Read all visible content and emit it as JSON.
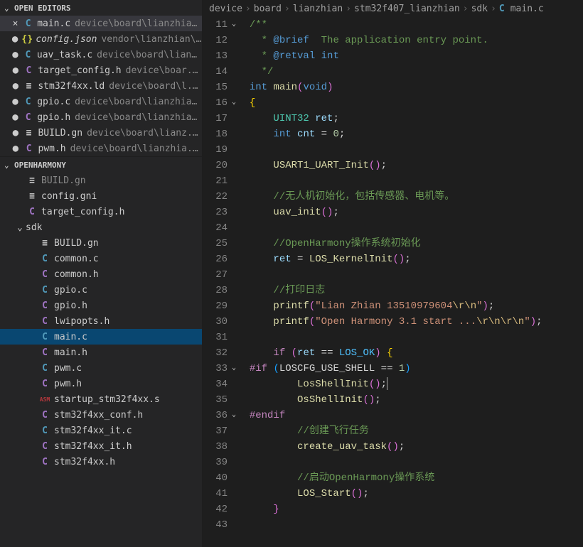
{
  "sections": {
    "openEditors": "OPEN EDITORS",
    "explorer": "OPENHARMONY"
  },
  "openEditors": [
    {
      "icon": "C",
      "iconClass": "icon-c",
      "name": "main.c",
      "path": "device\\board\\lianzhia...",
      "active": true,
      "close": true
    },
    {
      "icon": "{}",
      "iconClass": "icon-json",
      "name": "config.json",
      "path": "vendor\\lianzhian\\...",
      "italic": true,
      "dirty": true
    },
    {
      "icon": "C",
      "iconClass": "icon-c",
      "name": "uav_task.c",
      "path": "device\\board\\lian...",
      "dirty": true
    },
    {
      "icon": "C",
      "iconClass": "icon-h",
      "name": "target_config.h",
      "path": "device\\boar...",
      "dirty": true
    },
    {
      "icon": "≡",
      "iconClass": "icon-gn",
      "name": "stm32f4xx.ld",
      "path": "device\\board\\l...",
      "dirty": true
    },
    {
      "icon": "C",
      "iconClass": "icon-c",
      "name": "gpio.c",
      "path": "device\\board\\lianzhia...",
      "dirty": true
    },
    {
      "icon": "C",
      "iconClass": "icon-h",
      "name": "gpio.h",
      "path": "device\\board\\lianzhia...",
      "dirty": true
    },
    {
      "icon": "≡",
      "iconClass": "icon-gn",
      "name": "BUILD.gn",
      "path": "device\\board\\lianz...",
      "dirty": true
    },
    {
      "icon": "C",
      "iconClass": "icon-h",
      "name": "pwm.h",
      "path": "device\\board\\lianzhia...",
      "dirty": true
    }
  ],
  "tree": [
    {
      "type": "file",
      "icon": "≡",
      "iconClass": "icon-gn",
      "name": "BUILD.gn",
      "depth": 1,
      "cut": true
    },
    {
      "type": "file",
      "icon": "≡",
      "iconClass": "icon-gn",
      "name": "config.gni",
      "depth": 1
    },
    {
      "type": "file",
      "icon": "C",
      "iconClass": "icon-h",
      "name": "target_config.h",
      "depth": 1
    },
    {
      "type": "folder",
      "name": "sdk",
      "open": true,
      "depth": 0
    },
    {
      "type": "file",
      "icon": "≡",
      "iconClass": "icon-gn",
      "name": "BUILD.gn",
      "depth": 2
    },
    {
      "type": "file",
      "icon": "C",
      "iconClass": "icon-c",
      "name": "common.c",
      "depth": 2
    },
    {
      "type": "file",
      "icon": "C",
      "iconClass": "icon-h",
      "name": "common.h",
      "depth": 2
    },
    {
      "type": "file",
      "icon": "C",
      "iconClass": "icon-c",
      "name": "gpio.c",
      "depth": 2
    },
    {
      "type": "file",
      "icon": "C",
      "iconClass": "icon-h",
      "name": "gpio.h",
      "depth": 2
    },
    {
      "type": "file",
      "icon": "C",
      "iconClass": "icon-h",
      "name": "lwipopts.h",
      "depth": 2
    },
    {
      "type": "file",
      "icon": "C",
      "iconClass": "icon-c",
      "name": "main.c",
      "depth": 2,
      "selected": true
    },
    {
      "type": "file",
      "icon": "C",
      "iconClass": "icon-h",
      "name": "main.h",
      "depth": 2
    },
    {
      "type": "file",
      "icon": "C",
      "iconClass": "icon-c",
      "name": "pwm.c",
      "depth": 2
    },
    {
      "type": "file",
      "icon": "C",
      "iconClass": "icon-h",
      "name": "pwm.h",
      "depth": 2
    },
    {
      "type": "file",
      "icon": "ASM",
      "iconClass": "icon-asm",
      "name": "startup_stm32f4xx.s",
      "depth": 2
    },
    {
      "type": "file",
      "icon": "C",
      "iconClass": "icon-h",
      "name": "stm32f4xx_conf.h",
      "depth": 2
    },
    {
      "type": "file",
      "icon": "C",
      "iconClass": "icon-c",
      "name": "stm32f4xx_it.c",
      "depth": 2
    },
    {
      "type": "file",
      "icon": "C",
      "iconClass": "icon-h",
      "name": "stm32f4xx_it.h",
      "depth": 2
    },
    {
      "type": "file",
      "icon": "C",
      "iconClass": "icon-h",
      "name": "stm32f4xx.h",
      "depth": 2
    }
  ],
  "breadcrumbs": [
    "device",
    "board",
    "lianzhian",
    "stm32f407_lianzhian",
    "sdk",
    "main.c"
  ],
  "lineStart": 11,
  "lineEnd": 43,
  "code": [
    {
      "n": 11,
      "fold": "v",
      "t": [
        [
          "  ",
          "plain"
        ],
        [
          "/**",
          "comment"
        ]
      ]
    },
    {
      "n": 12,
      "t": [
        [
          "    * ",
          "comment"
        ],
        [
          "@brief",
          "doctag"
        ],
        [
          "  The application entry point.",
          "comment"
        ]
      ]
    },
    {
      "n": 13,
      "t": [
        [
          "    * ",
          "comment"
        ],
        [
          "@retval",
          "doctag"
        ],
        [
          " ",
          "comment"
        ],
        [
          "int",
          "keyword"
        ]
      ]
    },
    {
      "n": 14,
      "t": [
        [
          "    */",
          "comment"
        ]
      ]
    },
    {
      "n": 15,
      "t": [
        [
          "  ",
          "plain"
        ],
        [
          "int",
          "keyword"
        ],
        [
          " ",
          "plain"
        ],
        [
          "main",
          "func"
        ],
        [
          "(",
          "paren"
        ],
        [
          "void",
          "keyword"
        ],
        [
          ")",
          "paren"
        ]
      ]
    },
    {
      "n": 16,
      "fold": "v",
      "t": [
        [
          "  ",
          "plain"
        ],
        [
          "{",
          "brace"
        ]
      ]
    },
    {
      "n": 17,
      "t": [
        [
          "      ",
          "plain"
        ],
        [
          "UINT32",
          "type"
        ],
        [
          " ",
          "plain"
        ],
        [
          "ret",
          "var"
        ],
        [
          ";",
          "plain"
        ]
      ]
    },
    {
      "n": 18,
      "t": [
        [
          "      ",
          "plain"
        ],
        [
          "int",
          "keyword"
        ],
        [
          " ",
          "plain"
        ],
        [
          "cnt",
          "var"
        ],
        [
          " = ",
          "plain"
        ],
        [
          "0",
          "num"
        ],
        [
          ";",
          "plain"
        ]
      ]
    },
    {
      "n": 19,
      "t": []
    },
    {
      "n": 20,
      "t": [
        [
          "      ",
          "plain"
        ],
        [
          "USART1_UART_Init",
          "func"
        ],
        [
          "()",
          "paren"
        ],
        [
          ";",
          "plain"
        ]
      ]
    },
    {
      "n": 21,
      "t": []
    },
    {
      "n": 22,
      "t": [
        [
          "      ",
          "plain"
        ],
        [
          "//无人机初始化，包括传感器、电机等。",
          "comment"
        ]
      ]
    },
    {
      "n": 23,
      "t": [
        [
          "      ",
          "plain"
        ],
        [
          "uav_init",
          "func"
        ],
        [
          "()",
          "paren"
        ],
        [
          ";",
          "plain"
        ]
      ]
    },
    {
      "n": 24,
      "t": []
    },
    {
      "n": 25,
      "t": [
        [
          "      ",
          "plain"
        ],
        [
          "//OpenHarmony操作系统初始化",
          "comment"
        ]
      ]
    },
    {
      "n": 26,
      "t": [
        [
          "      ",
          "plain"
        ],
        [
          "ret",
          "var"
        ],
        [
          " = ",
          "plain"
        ],
        [
          "LOS_KernelInit",
          "func"
        ],
        [
          "()",
          "paren"
        ],
        [
          ";",
          "plain"
        ]
      ]
    },
    {
      "n": 27,
      "t": []
    },
    {
      "n": 28,
      "t": [
        [
          "      ",
          "plain"
        ],
        [
          "//打印日志",
          "comment"
        ]
      ]
    },
    {
      "n": 29,
      "t": [
        [
          "      ",
          "plain"
        ],
        [
          "printf",
          "func"
        ],
        [
          "(",
          "paren"
        ],
        [
          "\"Lian Zhian 13510979604",
          "str"
        ],
        [
          "\\r\\n",
          "esc"
        ],
        [
          "\"",
          "str"
        ],
        [
          ")",
          "paren"
        ],
        [
          ";",
          "plain"
        ]
      ]
    },
    {
      "n": 30,
      "t": [
        [
          "      ",
          "plain"
        ],
        [
          "printf",
          "func"
        ],
        [
          "(",
          "paren"
        ],
        [
          "\"Open Harmony 3.1 start ...",
          "str"
        ],
        [
          "\\r\\n\\r\\n",
          "esc"
        ],
        [
          "\"",
          "str"
        ],
        [
          ")",
          "paren"
        ],
        [
          ";",
          "plain"
        ]
      ]
    },
    {
      "n": 31,
      "t": []
    },
    {
      "n": 32,
      "t": [
        [
          "      ",
          "plain"
        ],
        [
          "if",
          "macro"
        ],
        [
          " ",
          "plain"
        ],
        [
          "(",
          "paren"
        ],
        [
          "ret",
          "var"
        ],
        [
          " == ",
          "plain"
        ],
        [
          "LOS_OK",
          "const"
        ],
        [
          ")",
          "paren"
        ],
        [
          " ",
          "plain"
        ],
        [
          "{",
          "brace"
        ]
      ]
    },
    {
      "n": 33,
      "fold": "v",
      "t": [
        [
          "  ",
          "plain"
        ],
        [
          "#if",
          "macro"
        ],
        [
          " ",
          "plain"
        ],
        [
          "(",
          "paren2"
        ],
        [
          "LOSCFG_USE_SHELL == ",
          "plain"
        ],
        [
          "1",
          "num"
        ],
        [
          ")",
          "paren2"
        ]
      ]
    },
    {
      "n": 34,
      "t": [
        [
          "          ",
          "plain"
        ],
        [
          "LosShellInit",
          "func"
        ],
        [
          "()",
          "paren"
        ],
        [
          ";",
          "plain"
        ],
        [
          "",
          "cursor"
        ]
      ]
    },
    {
      "n": 35,
      "t": [
        [
          "          ",
          "plain"
        ],
        [
          "OsShellInit",
          "func"
        ],
        [
          "()",
          "paren"
        ],
        [
          ";",
          "plain"
        ]
      ]
    },
    {
      "n": 36,
      "fold": "v",
      "t": [
        [
          "  ",
          "plain"
        ],
        [
          "#endif",
          "macro"
        ]
      ]
    },
    {
      "n": 37,
      "t": [
        [
          "          ",
          "plain"
        ],
        [
          "//创建飞行任务",
          "comment"
        ]
      ]
    },
    {
      "n": 38,
      "t": [
        [
          "          ",
          "plain"
        ],
        [
          "create_uav_task",
          "func"
        ],
        [
          "()",
          "paren"
        ],
        [
          ";",
          "plain"
        ]
      ]
    },
    {
      "n": 39,
      "t": []
    },
    {
      "n": 40,
      "t": [
        [
          "          ",
          "plain"
        ],
        [
          "//启动OpenHarmony操作系统",
          "comment"
        ]
      ]
    },
    {
      "n": 41,
      "t": [
        [
          "          ",
          "plain"
        ],
        [
          "LOS_Start",
          "func"
        ],
        [
          "()",
          "paren"
        ],
        [
          ";",
          "plain"
        ]
      ]
    },
    {
      "n": 42,
      "t": [
        [
          "      ",
          "plain"
        ],
        [
          "}",
          "paren"
        ]
      ]
    },
    {
      "n": 43,
      "t": []
    }
  ]
}
